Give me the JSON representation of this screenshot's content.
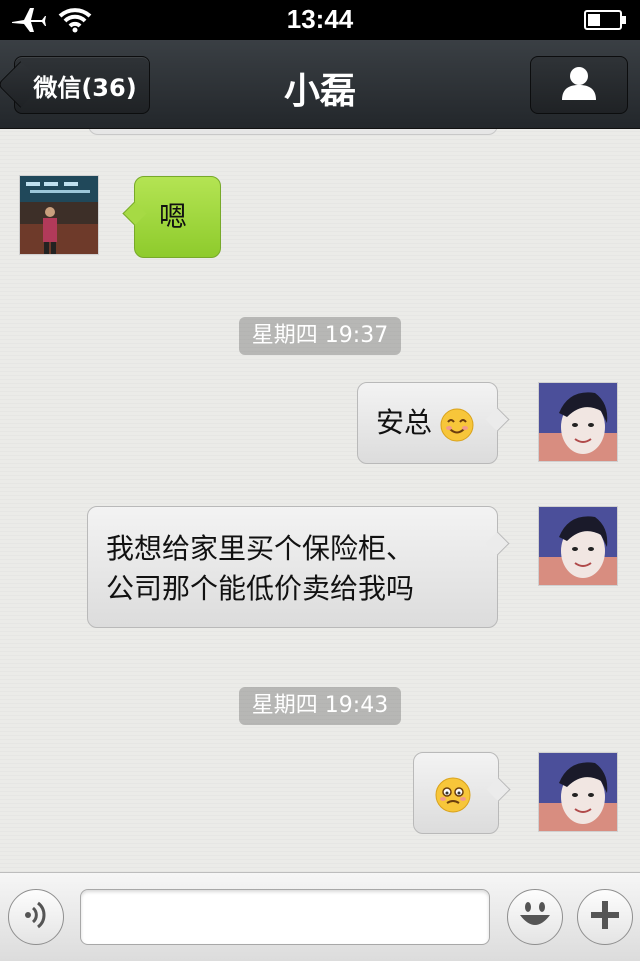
{
  "status_bar": {
    "time": "13:44"
  },
  "nav": {
    "back_label": "微信(36)",
    "title": "小磊"
  },
  "messages": [
    {
      "side": "left",
      "text": "嗯"
    },
    {
      "timestamp": "星期四 19:37"
    },
    {
      "side": "right",
      "text": "安总"
    },
    {
      "side": "right",
      "text_line1": "我想给家里买个保险柜、",
      "text_line2": "公司那个能低价卖给我吗"
    },
    {
      "timestamp": "星期四 19:43"
    },
    {
      "side": "right",
      "emoji_only": true
    }
  ],
  "input": {
    "value": "",
    "placeholder": ""
  },
  "icons": {
    "airplane": "airplane-icon",
    "wifi": "wifi-icon",
    "battery": "battery-icon",
    "profile": "person-icon",
    "voice": "voice-icon",
    "emoji": "smiley-icon",
    "add": "plus-icon"
  },
  "colors": {
    "green_bubble": "#9fd63b",
    "nav_bg": "#2b2f33"
  }
}
